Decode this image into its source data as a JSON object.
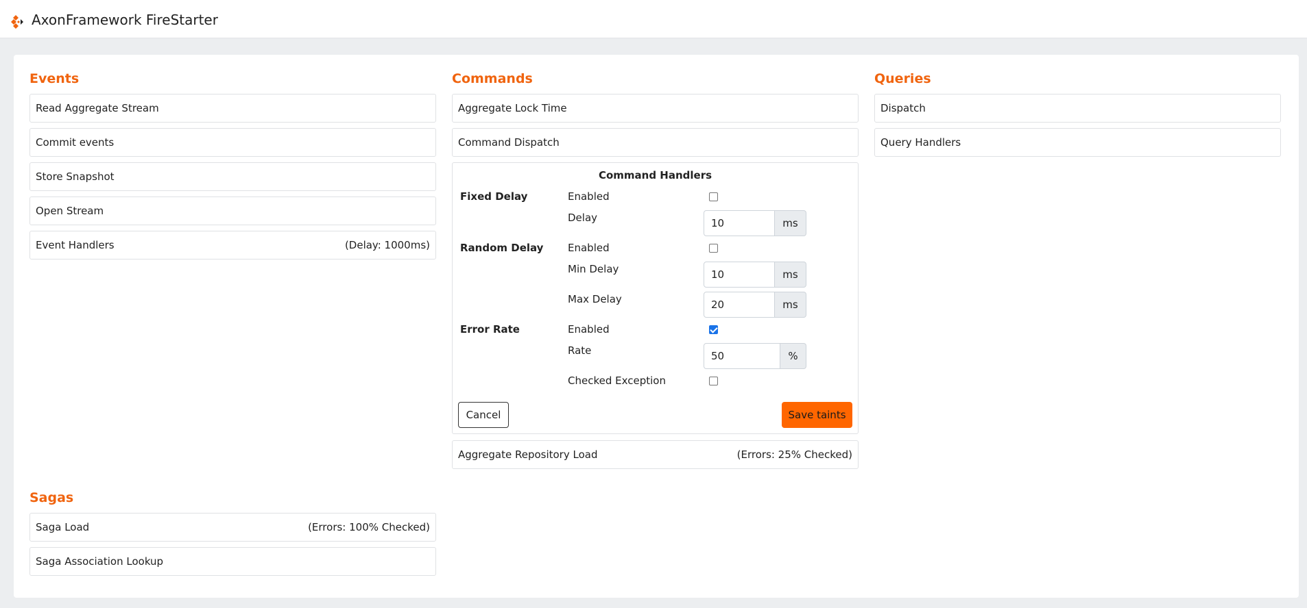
{
  "header": {
    "title": "AxonFramework FireStarter"
  },
  "events": {
    "title": "Events",
    "items": [
      {
        "label": "Read Aggregate Stream",
        "extra": ""
      },
      {
        "label": "Commit events",
        "extra": ""
      },
      {
        "label": "Store Snapshot",
        "extra": ""
      },
      {
        "label": "Open Stream",
        "extra": ""
      },
      {
        "label": "Event Handlers",
        "extra": "(Delay: 1000ms)"
      }
    ]
  },
  "commands": {
    "title": "Commands",
    "items": [
      {
        "label": "Aggregate Lock Time",
        "extra": ""
      },
      {
        "label": "Command Dispatch",
        "extra": ""
      }
    ],
    "handlers_panel": {
      "title": "Command Handlers",
      "fixed_delay": {
        "label": "Fixed Delay",
        "enabled_label": "Enabled",
        "enabled": false,
        "delay_label": "Delay",
        "delay_value": "10",
        "delay_unit": "ms"
      },
      "random_delay": {
        "label": "Random Delay",
        "enabled_label": "Enabled",
        "enabled": false,
        "min_label": "Min Delay",
        "min_value": "10",
        "min_unit": "ms",
        "max_label": "Max Delay",
        "max_value": "20",
        "max_unit": "ms"
      },
      "error_rate": {
        "label": "Error Rate",
        "enabled_label": "Enabled",
        "enabled": true,
        "rate_label": "Rate",
        "rate_value": "50",
        "rate_unit": "%",
        "checked_label": "Checked Exception",
        "checked": false
      },
      "cancel_label": "Cancel",
      "save_label": "Save taints"
    },
    "after_items": [
      {
        "label": "Aggregate Repository Load",
        "extra": "(Errors: 25% Checked)"
      }
    ]
  },
  "queries": {
    "title": "Queries",
    "items": [
      {
        "label": "Dispatch",
        "extra": ""
      },
      {
        "label": "Query Handlers",
        "extra": ""
      }
    ]
  },
  "sagas": {
    "title": "Sagas",
    "items": [
      {
        "label": "Saga Load",
        "extra": "(Errors: 100% Checked)"
      },
      {
        "label": "Saga Association Lookup",
        "extra": ""
      }
    ]
  },
  "colors": {
    "accent": "#f0640f",
    "save_button": "#ff6600",
    "checkbox_checked": "#1a73e8"
  }
}
